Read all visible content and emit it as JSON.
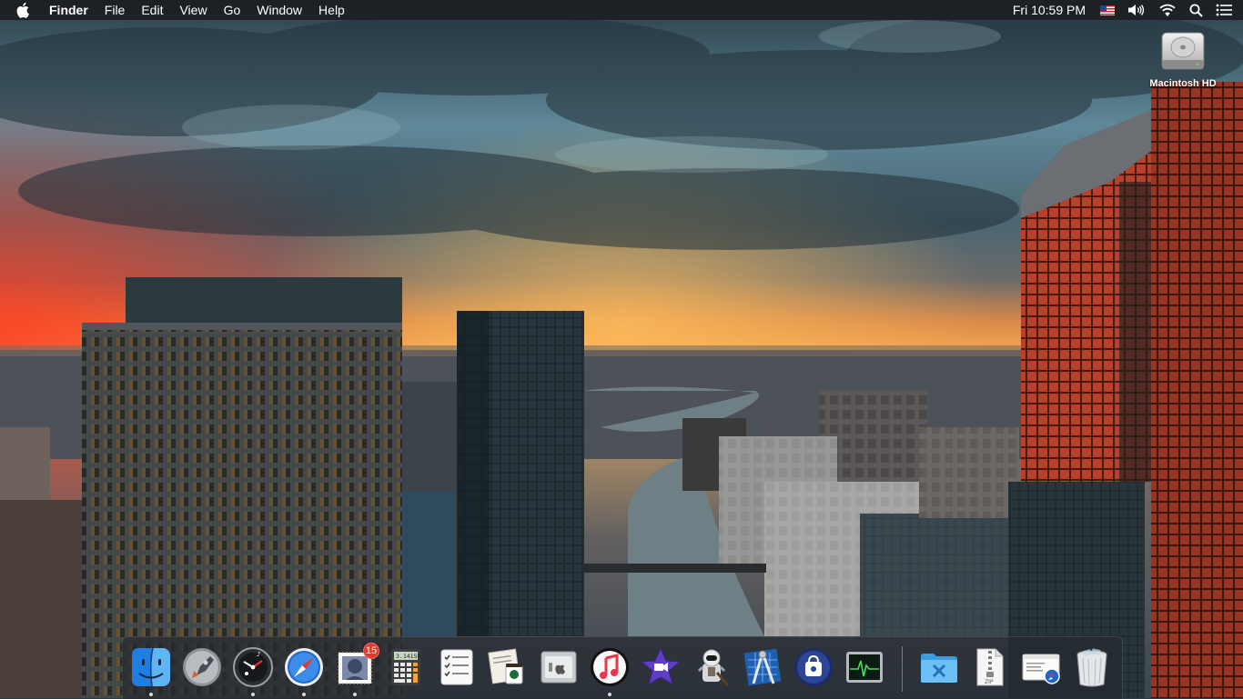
{
  "menubar": {
    "app_name": "Finder",
    "menus": [
      "File",
      "Edit",
      "View",
      "Go",
      "Window",
      "Help"
    ],
    "clock": "Fri 10:59 PM"
  },
  "desktop": {
    "icons": [
      {
        "label": "Macintosh HD",
        "icon": "hard-drive-icon"
      }
    ]
  },
  "dock": {
    "items": [
      {
        "name": "finder",
        "icon": "finder-icon",
        "running": true
      },
      {
        "name": "launchpad",
        "icon": "launchpad-icon",
        "running": false
      },
      {
        "name": "dashboard",
        "icon": "dashboard-icon",
        "running": true
      },
      {
        "name": "safari",
        "icon": "safari-icon",
        "running": true
      },
      {
        "name": "mail",
        "icon": "mail-icon",
        "running": true,
        "badge": "15"
      },
      {
        "name": "calculator",
        "icon": "calculator-icon",
        "running": false,
        "display_text": "3.14159"
      },
      {
        "name": "reminders",
        "icon": "reminders-icon",
        "running": false
      },
      {
        "name": "notes-coffee",
        "icon": "coffee-notes-icon",
        "running": false
      },
      {
        "name": "boot-camp",
        "icon": "boot-camp-icon",
        "running": false
      },
      {
        "name": "itunes",
        "icon": "itunes-icon",
        "running": true
      },
      {
        "name": "imovie",
        "icon": "imovie-icon",
        "running": false
      },
      {
        "name": "automator",
        "icon": "automator-icon",
        "running": false
      },
      {
        "name": "xcode-instruments",
        "icon": "instruments-icon",
        "running": false
      },
      {
        "name": "app-store",
        "icon": "app-store-icon",
        "running": false
      },
      {
        "name": "activity-monitor",
        "icon": "activity-monitor-icon",
        "running": false
      },
      {
        "name": "utilities-folder",
        "icon": "utilities-folder-icon",
        "running": false
      },
      {
        "name": "zip-archive",
        "icon": "zip-file-icon",
        "running": false,
        "file_label": "ZIP"
      },
      {
        "name": "safari-downloads",
        "icon": "downloads-stack-icon",
        "running": false
      },
      {
        "name": "trash",
        "icon": "trash-icon",
        "running": false
      }
    ]
  },
  "colors": {
    "menubar_bg": "#1c1e22",
    "badge": "#e8362c",
    "sky_top": "#2e4650",
    "sunset": "#f07a2a"
  }
}
